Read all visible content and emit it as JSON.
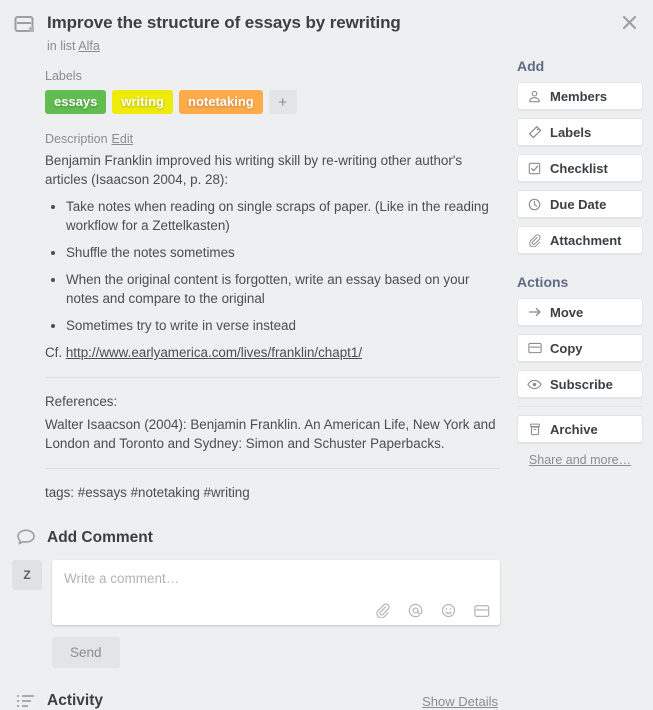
{
  "card": {
    "title": "Improve the structure of essays by rewriting",
    "in_list_prefix": "in list",
    "list_name": "Alfa",
    "card_icon": "card-icon",
    "close_icon": "close-icon"
  },
  "labels": {
    "heading": "Labels",
    "items": [
      {
        "text": "essays",
        "color": "#61bd4f"
      },
      {
        "text": "writing",
        "color": "#eeea0b"
      },
      {
        "text": "notetaking",
        "color": "#ffab4a"
      }
    ],
    "add_label": "+"
  },
  "description": {
    "heading": "Description",
    "edit_label": "Edit",
    "intro": "Benjamin Franklin improved his writing skill by re-writing other author's articles (Isaacson 2004, p. 28):",
    "bullets": [
      "Take notes when reading on single scraps of paper. (Like in the reading workflow for a Zettelkasten)",
      "Shuffle the notes sometimes",
      "When the original content is forgotten, write an essay based on your notes and compare to the original",
      "Sometimes try to write in verse instead"
    ],
    "cf_prefix": "Cf. ",
    "cf_link": "http://www.earlyamerica.com/lives/franklin/chapt1/",
    "references_heading": "References:",
    "reference_entry": "Walter Isaacson (2004): Benjamin Franklin. An American Life, New York and London and Toronto and Sydney: Simon and Schuster Paperbacks.",
    "tags_line": "tags: #essays #notetaking #writing"
  },
  "comment": {
    "section_title": "Add Comment",
    "section_icon": "comment-bubble-icon",
    "avatar_initial": "Z",
    "placeholder": "Write a comment…",
    "value": "",
    "send_label": "Send",
    "tools": [
      {
        "name": "attachment-icon"
      },
      {
        "name": "mention-icon"
      },
      {
        "name": "emoji-icon"
      },
      {
        "name": "card-icon"
      }
    ]
  },
  "activity": {
    "section_title": "Activity",
    "section_icon": "activity-list-icon",
    "show_details_label": "Show Details"
  },
  "sidebar": {
    "add_heading": "Add",
    "add_items": [
      {
        "label": "Members",
        "icon": "member-icon"
      },
      {
        "label": "Labels",
        "icon": "label-tag-icon"
      },
      {
        "label": "Checklist",
        "icon": "checklist-icon"
      },
      {
        "label": "Due Date",
        "icon": "clock-icon"
      },
      {
        "label": "Attachment",
        "icon": "paperclip-icon"
      }
    ],
    "actions_heading": "Actions",
    "action_items": [
      {
        "label": "Move",
        "icon": "arrow-right-icon"
      },
      {
        "label": "Copy",
        "icon": "copy-card-icon"
      },
      {
        "label": "Subscribe",
        "icon": "eye-icon"
      }
    ],
    "archive": {
      "label": "Archive",
      "icon": "archive-box-icon"
    },
    "share_more_label": "Share and more…"
  },
  "theme": {
    "background": "#edeff0",
    "text": "#4d4d4d",
    "muted": "#8c8c8c",
    "heading": "#3c4043"
  }
}
